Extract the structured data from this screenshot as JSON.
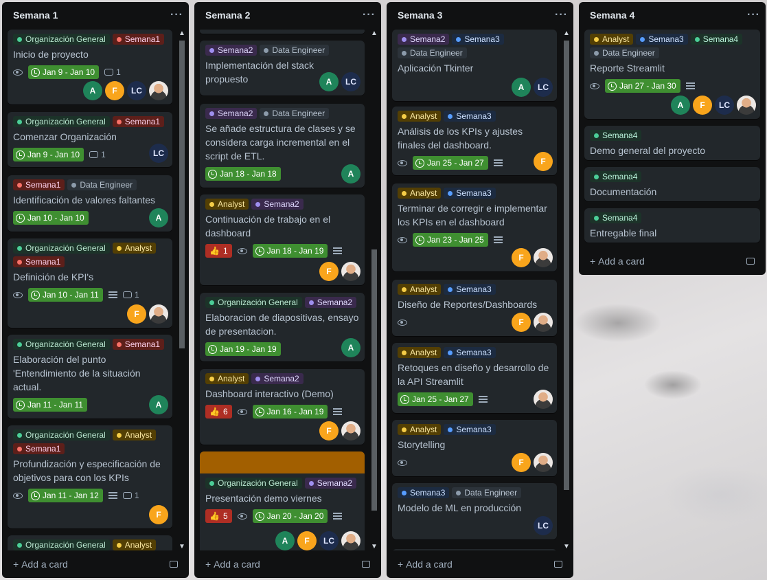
{
  "lists": [
    {
      "title": "Semana 1",
      "add_label": "Add a card",
      "cards": [
        {
          "labels": [
            "Organización General",
            "Semana1"
          ],
          "title": "Inicio de proyecto",
          "date": "Jan 9 - Jan 10",
          "comments": "1"
        },
        {
          "labels": [
            "Organización General",
            "Semana1"
          ],
          "title": "Comenzar Organización",
          "date": "Jan 9 - Jan 10",
          "comments": "1"
        },
        {
          "labels": [
            "Semana1",
            "Data Engineer"
          ],
          "title": "Identificación de valores faltantes",
          "date": "Jan 10 - Jan 10"
        },
        {
          "labels": [
            "Organización General",
            "Analyst",
            "Semana1"
          ],
          "title": "Definición de KPI's",
          "date": "Jan 10 - Jan 11",
          "comments": "1"
        },
        {
          "labels": [
            "Organización General",
            "Semana1"
          ],
          "title": "Elaboración del punto 'Entendimiento de la situación actual.",
          "date": "Jan 11 - Jan 11"
        },
        {
          "labels": [
            "Organización General",
            "Analyst",
            "Semana1"
          ],
          "title": "Profundización y especificación de objetivos para con los KPIs",
          "date": "Jan 11 - Jan 12",
          "comments": "1"
        },
        {
          "labels": [
            "Organización General",
            "Analyst"
          ]
        }
      ]
    },
    {
      "title": "Semana 2",
      "add_label": "Add a card",
      "cards": [
        {
          "labels": [
            "Semana2",
            "Data Engineer"
          ],
          "title": "Implementación del stack propuesto"
        },
        {
          "labels": [
            "Semana2",
            "Data Engineer"
          ],
          "title": "Se añade estructura de clases y se considera carga incremental en el script de ETL.",
          "date": "Jan 18 - Jan 18"
        },
        {
          "labels": [
            "Analyst",
            "Semana2"
          ],
          "title": "Continuación de trabajo en el dashboard",
          "votes": "1",
          "date": "Jan 18 - Jan 19"
        },
        {
          "labels": [
            "Organización General",
            "Semana2"
          ],
          "title": "Elaboracion de diapositivas, ensayo de presentacion.",
          "date": "Jan 19 - Jan 19"
        },
        {
          "labels": [
            "Analyst",
            "Semana2"
          ],
          "title": "Dashboard interactivo (Demo)",
          "votes": "6",
          "date": "Jan 16 - Jan 19"
        },
        {
          "labels": [
            "Organización General",
            "Semana2"
          ],
          "title": "Presentación demo viernes",
          "votes": "5",
          "date": "Jan 20 - Jan 20"
        }
      ]
    },
    {
      "title": "Semana 3",
      "add_label": "Add a card",
      "cards": [
        {
          "labels": [
            "Semana2",
            "Semana3",
            "Data Engineer"
          ],
          "title": "Aplicación Tkinter"
        },
        {
          "labels": [
            "Analyst",
            "Semana3"
          ],
          "title": "Análisis de los KPIs y ajustes finales del dashboard.",
          "date": "Jan 25 - Jan 27"
        },
        {
          "labels": [
            "Analyst",
            "Semana3"
          ],
          "title": "Terminar de corregir e implementar los KPIs en el dashboard",
          "date": "Jan 23 - Jan 25"
        },
        {
          "labels": [
            "Analyst",
            "Semana3"
          ],
          "title": "Diseño de Reportes/Dashboards"
        },
        {
          "labels": [
            "Analyst",
            "Semana3"
          ],
          "title": "Retoques en diseño y desarrollo de la API Streamlit",
          "date": "Jan 25 - Jan 27"
        },
        {
          "labels": [
            "Analyst",
            "Semana3"
          ],
          "title": "Storytelling"
        },
        {
          "labels": [
            "Semana3",
            "Data Engineer"
          ],
          "title": "Modelo de ML en producción"
        }
      ]
    },
    {
      "title": "Semana 4",
      "add_label": "Add a card",
      "cards": [
        {
          "labels": [
            "Analyst",
            "Semana3",
            "Semana4",
            "Data Engineer"
          ],
          "title": "Reporte Streamlit",
          "date": "Jan 27 - Jan 30"
        },
        {
          "labels": [
            "Semana4"
          ],
          "title": "Demo general del proyecto"
        },
        {
          "labels": [
            "Semana4"
          ],
          "title": "Documentación"
        },
        {
          "labels": [
            "Semana4"
          ],
          "title": "Entregable final"
        }
      ]
    }
  ],
  "avatars": {
    "a": "A",
    "f": "F",
    "lc": "LC"
  },
  "colors": {
    "date_badge": "#3f8f31",
    "vote_badge": "#ae2e24",
    "cover": "#a25f00",
    "list_bg": "#101112",
    "card_bg": "#22272b"
  }
}
